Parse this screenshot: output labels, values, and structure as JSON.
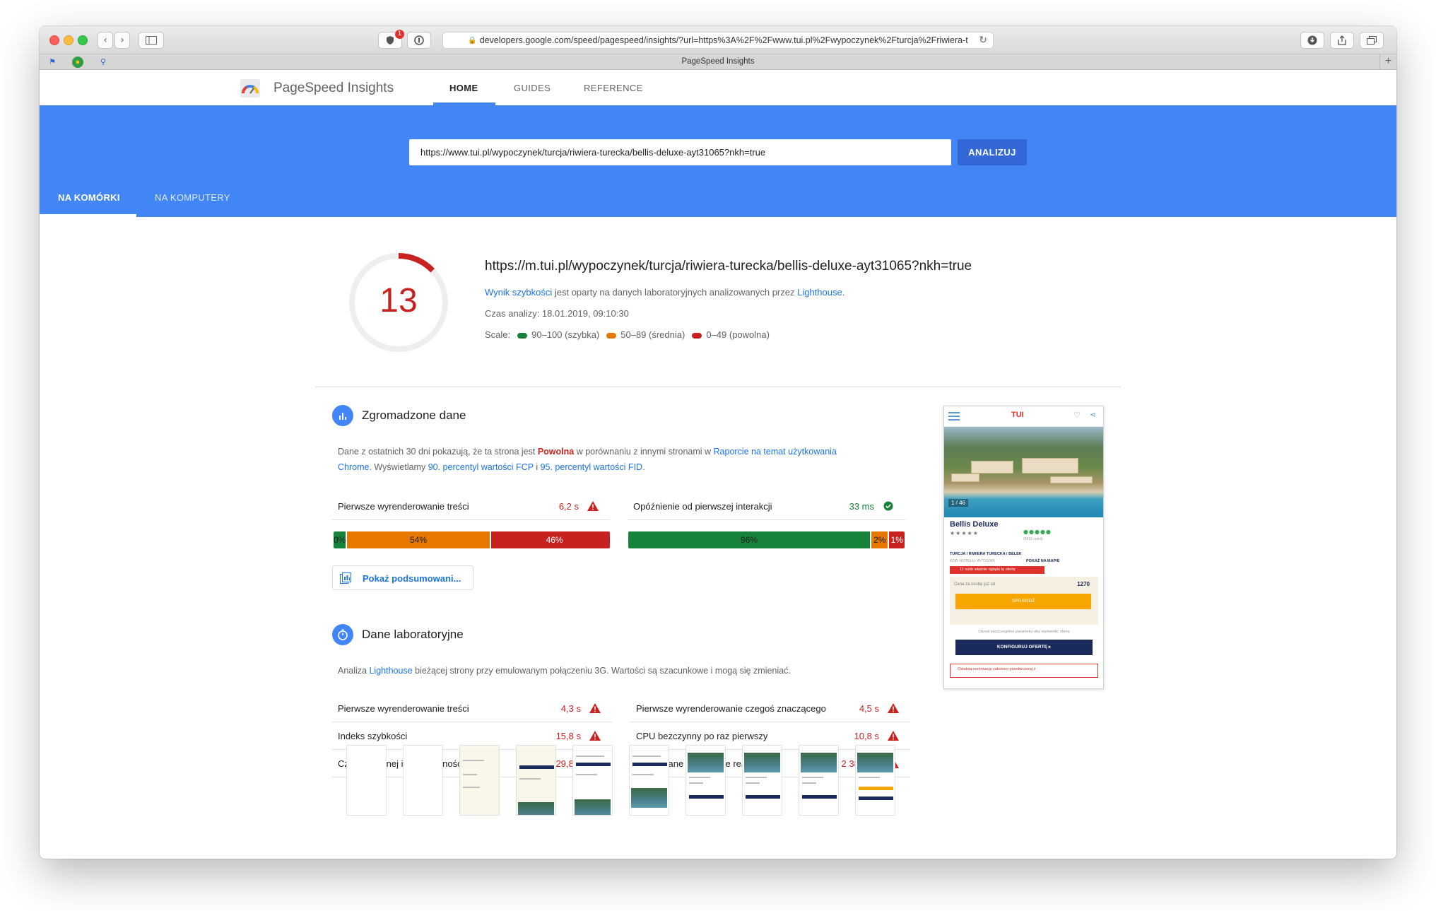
{
  "browser": {
    "address_url": "developers.google.com/speed/pagespeed/insights/?url=https%3A%2F%2Fwww.tui.pl%2Fwypoczynek%2Fturcja%2Friwiera-t",
    "tab_title": "PageSpeed Insights",
    "extension_badge": "1"
  },
  "header": {
    "brand": "PageSpeed Insights",
    "nav": [
      "HOME",
      "GUIDES",
      "REFERENCE"
    ]
  },
  "hero": {
    "url_value": "https://www.tui.pl/wypoczynek/turcja/riwiera-turecka/bellis-deluxe-ayt31065?nkh=true",
    "analyze_label": "ANALIZUJ",
    "tabs": [
      "NA KOMÓRKI",
      "NA KOMPUTERY"
    ]
  },
  "score": {
    "value": "13",
    "fraction": 0.13,
    "url": "https://m.tui.pl/wypoczynek/turcja/riwiera-turecka/bellis-deluxe-ayt31065?nkh=true",
    "line1_link": "Wynik szybkości",
    "line1_mid": " jest oparty na danych laboratoryjnych analizowanych przez ",
    "line1_link2": "Lighthouse",
    "line1_end": ".",
    "analysis_time": "Czas analizy: 18.01.2019, 09:10:30",
    "scale_label": "Scale:",
    "scale": [
      {
        "label": "90–100 (szybka)",
        "color": "#178239"
      },
      {
        "label": "50–89 (średnia)",
        "color": "#e67700"
      },
      {
        "label": "0–49 (powolna)",
        "color": "#c7221f"
      }
    ]
  },
  "field": {
    "title": "Zgromadzone dane",
    "p1": "Dane z ostatnich 30 dni pokazują, że ta strona jest ",
    "p1_bold": "Powolna",
    "p1_mid": " w porównaniu z innymi stronami w ",
    "p1_link": "Raporcie na temat użytkowania",
    "p2_link_a": "Chrome",
    "p2_mid": ". Wyświetlamy ",
    "p2_link_b": "90. percentyl wartości FCP",
    "p2_and": " i ",
    "p2_link_c": "95. percentyl wartości FID",
    "p2_end": ".",
    "metrics": [
      {
        "name": "Pierwsze wyrenderowanie treści",
        "value": "6,2 s",
        "status": "slow",
        "distribution": [
          {
            "label": "0%",
            "pct": 0.02,
            "color": "#178239"
          },
          {
            "label": "54%",
            "pct": 0.52,
            "color": "#e67700"
          },
          {
            "label": "46%",
            "pct": 0.46,
            "color": "#c7221f"
          }
        ]
      },
      {
        "name": "Opóźnienie od pierwszej interakcji",
        "value": "33 ms",
        "status": "fast",
        "distribution": [
          {
            "label": "96%",
            "pct": 0.88,
            "color": "#178239"
          },
          {
            "label": "2%",
            "pct": 0.065,
            "color": "#e67700"
          },
          {
            "label": "1%",
            "pct": 0.055,
            "color": "#c7221f"
          }
        ]
      }
    ],
    "summary_button": "Pokaż podsumowani..."
  },
  "lab": {
    "title": "Dane laboratoryjne",
    "p1": "Analiza ",
    "p1_link": "Lighthouse",
    "p1_end": " bieżącej strony przy emulowanym połączeniu 3G. Wartości są szacunkowe i mogą się zmieniać.",
    "metrics": [
      {
        "name": "Pierwsze wyrenderowanie treści",
        "value": "4,3 s"
      },
      {
        "name": "Indeks szybkości",
        "value": "15,8 s"
      },
      {
        "name": "Czas do pełnej interaktywności",
        "value": "29,8 s"
      },
      {
        "name": "Pierwsze wyrenderowanie czegoś znaczącego",
        "value": "4,5 s"
      },
      {
        "name": "CPU bezczynny po raz pierwszy",
        "value": "10,8 s"
      },
      {
        "name": "Szacowane opóźnienie reakcji",
        "value": "2 380 ms"
      }
    ]
  },
  "phone": {
    "logo": "TUI",
    "counter": "1 / 46",
    "hotel_name": "Bellis Deluxe",
    "stars": "★★★★★",
    "ta_dots": "●●●●●",
    "ta_reviews": "(5816 opinii)",
    "location": "TURCJA / RIWIERA TURECKA / BELEK",
    "code": "KOD HOTELU: AYT31065",
    "map_link": "POKAŻ NA MAPIE",
    "alert": "11 osób właśnie ogląda tę ofertę",
    "price_label": "Cena za osobę już od",
    "price_value": "1270",
    "check_button": "SPRAWDŹ",
    "hint": "Określ poszczególne parametry aby wyświetlić ofertę",
    "configure_button": "KONFIGURUJ OFERTĘ ▸",
    "bottom_note": "Ostatnią rezerwację założono przedwczoraj z"
  },
  "colors": {
    "accent": "#4285f4",
    "fast": "#178239",
    "average": "#e67700",
    "slow": "#c7221f"
  }
}
